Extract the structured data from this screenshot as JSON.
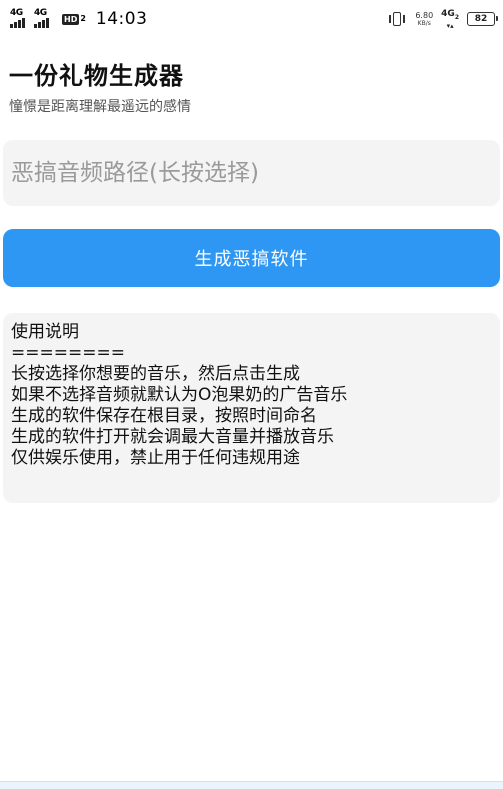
{
  "status_bar": {
    "sim1_network": "4G",
    "sim2_network": "4G",
    "hd_label": "HD",
    "hd_sim": "2",
    "time": "14:03",
    "net_speed_value": "6.80",
    "net_speed_unit": "KB/s",
    "data_network": "4G",
    "data_sim": "2",
    "data_arrows": "▾▴",
    "battery_level": "82"
  },
  "header": {
    "title": "一份礼物生成器",
    "subtitle": "憧憬是距离理解最遥远的感情"
  },
  "form": {
    "audio_path_value": "",
    "audio_path_placeholder": "恶搞音频路径(长按选择)",
    "generate_button_label": "生成恶搞软件"
  },
  "instructions": {
    "lines": [
      "使用说明",
      "========",
      "长按选择你想要的音乐，然后点击生成",
      "如果不选择音频就默认为O泡果奶的广告音乐",
      "生成的软件保存在根目录，按照时间命名",
      "生成的软件打开就会调最大音量并播放音乐",
      "仅供娱乐使用，禁止用于任何违规用途"
    ]
  },
  "colors": {
    "accent": "#2d97f3",
    "card_background": "#f4f4f4",
    "placeholder": "#9a9a9a"
  },
  "icons": {
    "signal": "signal-bars-icon",
    "hd_call": "hd-voice-icon",
    "vibrate": "vibrate-icon",
    "battery": "battery-icon"
  }
}
